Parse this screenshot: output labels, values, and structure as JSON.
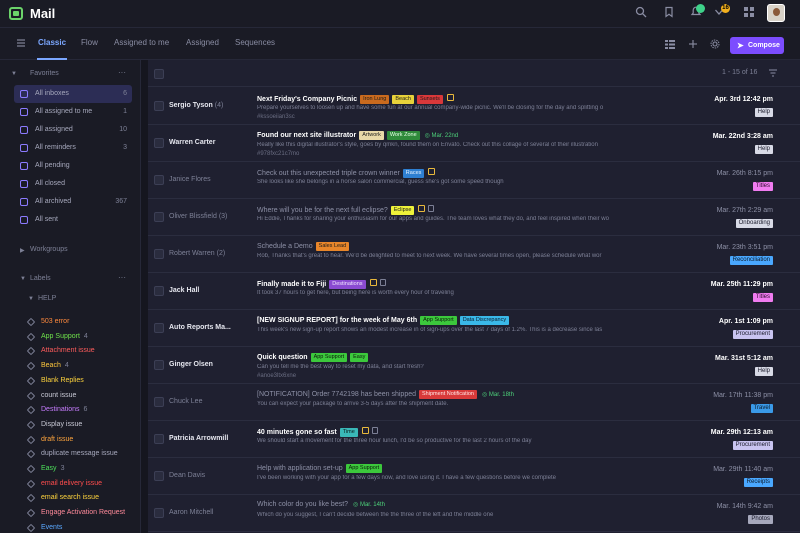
{
  "app": {
    "title": "Mail"
  },
  "topbar": {
    "icons": [
      "search-icon",
      "bookmark-icon",
      "notifications-icon",
      "alerts-icon"
    ],
    "badge_count": "16"
  },
  "tabs": [
    {
      "label": "Classic",
      "active": true
    },
    {
      "label": "Flow"
    },
    {
      "label": "Assigned to me"
    },
    {
      "label": "Assigned"
    },
    {
      "label": "Sequences"
    }
  ],
  "compose_label": "Compose",
  "sidebar": {
    "favorites_label": "Favorites",
    "items": [
      {
        "label": "All inboxes",
        "count": "6",
        "active": true
      },
      {
        "label": "All assigned to me",
        "count": "1"
      },
      {
        "label": "All assigned",
        "count": "10"
      },
      {
        "label": "All reminders",
        "count": "3"
      },
      {
        "label": "All pending",
        "count": ""
      },
      {
        "label": "All closed",
        "count": ""
      },
      {
        "label": "All archived",
        "count": "367"
      },
      {
        "label": "All sent",
        "count": ""
      }
    ],
    "workgroups_label": "Workgroups",
    "labels_label": "Labels",
    "help_label": "HELP",
    "labels": [
      {
        "label": "503 error",
        "count": "",
        "color": "#ff8a3d"
      },
      {
        "label": "App Support",
        "count": "4",
        "color": "#6ee14a"
      },
      {
        "label": "Attachment issue",
        "count": "",
        "color": "#ff5c5c"
      },
      {
        "label": "Beach",
        "count": "4",
        "color": "#ffc83d"
      },
      {
        "label": "Blank Replies",
        "count": "",
        "color": "#ffd43d"
      },
      {
        "label": "count issue",
        "count": "",
        "color": "#c9cad6"
      },
      {
        "label": "Destinations",
        "count": "6",
        "color": "#c77dff"
      },
      {
        "label": "Display issue",
        "count": "",
        "color": "#c9cad6"
      },
      {
        "label": "draft issue",
        "count": "",
        "color": "#ffa53d"
      },
      {
        "label": "duplicate message issue",
        "count": "",
        "color": "#a6a8bc"
      },
      {
        "label": "Easy",
        "count": "3",
        "color": "#4de15a"
      },
      {
        "label": "email delivery issue",
        "count": "",
        "color": "#ff4d4d"
      },
      {
        "label": "email search issue",
        "count": "",
        "color": "#ffd43d"
      },
      {
        "label": "Engage Activation Request",
        "count": "",
        "color": "#ff8a9a"
      },
      {
        "label": "Events",
        "count": "",
        "color": "#5aa8ff"
      }
    ]
  },
  "list": {
    "pagination": "1 - 15 of 16"
  },
  "emails": [
    {
      "sender": "Sergio Tyson",
      "count": "(4)",
      "unread": true,
      "subject": "Next Friday's Company Picnic",
      "chips": [
        {
          "t": "Iron Lung",
          "bg": "#c96a1e",
          "fg": "#1a1a1a"
        },
        {
          "t": "Beach",
          "bg": "#e8d23a",
          "fg": "#1a1a1a"
        },
        {
          "t": "Sunsets",
          "bg": "#d9383a",
          "fg": "#1a1a1a"
        }
      ],
      "icons": [
        "note"
      ],
      "preview": "Prepare yourselves to loosen up and have some fun at our annual company-wide picnic. We'll be closing for the day and splitting o",
      "hash": "#kssoeiian3sc",
      "date": "Apr. 3rd 12:42 pm",
      "tag": "Help",
      "tag_bg": "#d8dae6",
      "tag_fg": "#1a1a2a"
    },
    {
      "sender": "Warren Carter",
      "count": "",
      "unread": true,
      "subject": "Found our next site illustrator",
      "chips": [
        {
          "t": "Artwork",
          "bg": "#e8d9a8",
          "fg": "#1a1a1a"
        },
        {
          "t": "Work Zone",
          "bg": "#2f8a3a",
          "fg": "#e8ffe8"
        }
      ],
      "dchip": "Mar. 22nd",
      "preview": "Really like this digital illustrator's style, goes by qmkn, found them on Envato. Check out this collage of several of their illustration",
      "hash": "#978fxc21c7mo",
      "date": "Mar. 22nd 3:28 am",
      "tag": "Help",
      "tag_bg": "#d8dae6",
      "tag_fg": "#1a1a2a"
    },
    {
      "sender": "Janice Flores",
      "count": "",
      "unread": false,
      "subject": "Check out this unexpected triple crown winner",
      "chips": [
        {
          "t": "Races",
          "bg": "#2e7fd1",
          "fg": "#e6f2ff"
        }
      ],
      "icons": [
        "note"
      ],
      "preview": "She looks like she belongs in a horse salon commercial, guess she's got some speed though",
      "hash": "",
      "date": "Mar. 26th 8:15 pm",
      "tag": "Titles",
      "tag_bg": "#f07cf0",
      "tag_fg": "#2a0a2a"
    },
    {
      "sender": "Oliver Blissfield",
      "count": "(3)",
      "unread": false,
      "subject": "Where will you be for the next full eclipse?",
      "chips": [
        {
          "t": "Eclipse",
          "bg": "#eef23a",
          "fg": "#1a1a1a"
        }
      ],
      "icons": [
        "note",
        "cal"
      ],
      "preview": "Hi Eddie, Thanks for sharing your enthusiasm for our apps and guides. The team loves what they do, and feel inspired when their wo",
      "hash": "",
      "date": "Mar. 27th 2:29 am",
      "tag": "Onboarding",
      "tag_bg": "#d8dae6",
      "tag_fg": "#1a1a2a"
    },
    {
      "sender": "Robert Warren",
      "count": "(2)",
      "unread": false,
      "subject": "Schedule a Demo",
      "chips": [
        {
          "t": "Sales Lead",
          "bg": "#e8862a",
          "fg": "#1a1a1a"
        }
      ],
      "preview": "Rob, Thanks that's great to hear. We'd be delighted to meet to next week. We have several times open, please schedule what wor",
      "hash": "",
      "date": "Mar. 23th 3:51 pm",
      "tag": "Reconciliation",
      "tag_bg": "#4aa8ff",
      "tag_fg": "#0a1a2a"
    },
    {
      "sender": "Jack Hall",
      "count": "",
      "unread": true,
      "subject": "Finally made it to Fiji",
      "chips": [
        {
          "t": "Destinations",
          "bg": "#8a4ad1",
          "fg": "#f2e6ff"
        }
      ],
      "icons": [
        "note",
        "cal"
      ],
      "preview": "It took 37 hours to get here, but being here is worth every hour of traveling",
      "hash": "",
      "date": "Mar. 25th 11:29 pm",
      "tag": "Titles",
      "tag_bg": "#f07cf0",
      "tag_fg": "#2a0a2a"
    },
    {
      "sender": "Auto Reports Ma...",
      "count": "",
      "unread": true,
      "subject": "[NEW SIGNUP REPORT] for the week of May 6th",
      "chips": [
        {
          "t": "App Support",
          "bg": "#3cc83c",
          "fg": "#0a1a0a"
        },
        {
          "t": "Data Discrepancy",
          "bg": "#3ab8e8",
          "fg": "#0a1a2a"
        }
      ],
      "preview": "This week's new sign-up report shows an modest increase in of sign-ups over the last 7 days of 1.2%. This is a decrease since las",
      "hash": "",
      "date": "Apr. 1st 1:09 pm",
      "tag": "Procurement",
      "tag_bg": "#c9c4f0",
      "tag_fg": "#1a1a2a"
    },
    {
      "sender": "Ginger Olsen",
      "count": "",
      "unread": true,
      "subject": "Quick question",
      "chips": [
        {
          "t": "App Support",
          "bg": "#3cc83c",
          "fg": "#0a1a0a"
        },
        {
          "t": "Easy",
          "bg": "#3cc83c",
          "fg": "#0a1a0a"
        }
      ],
      "preview": "Can you tell me the best way to reset my data, and start fresh?",
      "hash": "#anoe3ltx6xne",
      "date": "Mar. 31st 5:12 am",
      "tag": "Help",
      "tag_bg": "#d8dae6",
      "tag_fg": "#1a1a2a"
    },
    {
      "sender": "Chuck Lee",
      "count": "",
      "unread": false,
      "subject": "[NOTIFICATION] Order 7742198 has been shipped",
      "chips": [
        {
          "t": "Shipment Notification",
          "bg": "#d93a3a",
          "fg": "#ffe6e6"
        }
      ],
      "dchip": "Mar. 18th",
      "preview": "You can expect your package to arrive 3-5 days after the shipment date.",
      "hash": "",
      "date": "Mar. 17th 11:38 pm",
      "tag": "Travel",
      "tag_bg": "#3a9ae8",
      "tag_fg": "#0a1a2a"
    },
    {
      "sender": "Patricia Arrowmill",
      "count": "",
      "unread": true,
      "subject": "40 minutes gone so fast",
      "chips": [
        {
          "t": "Time",
          "bg": "#3ab8b8",
          "fg": "#0a1a1a"
        }
      ],
      "icons": [
        "note",
        "cal"
      ],
      "preview": "We should start a movement for the three hour lunch, I'd be so productive for the last 2 hours of the day",
      "hash": "",
      "date": "Mar. 29th 12:13 am",
      "tag": "Procurement",
      "tag_bg": "#c9c4f0",
      "tag_fg": "#1a1a2a"
    },
    {
      "sender": "Dean Davis",
      "count": "",
      "unread": false,
      "subject": "Help with application set-up",
      "chips": [
        {
          "t": "App Support",
          "bg": "#3cc83c",
          "fg": "#0a1a0a"
        }
      ],
      "preview": "I've been working with your app for a few days now, and love using it. I have a few questions before we complete",
      "hash": "",
      "date": "Mar. 29th 11:40 am",
      "tag": "Receipts",
      "tag_bg": "#4aa8ff",
      "tag_fg": "#0a1a2a"
    },
    {
      "sender": "Aaron Mitchell",
      "count": "",
      "unread": false,
      "subject": "Which color do you like best?",
      "chips": [],
      "dchip": "Mar. 14th",
      "preview": "Which do you suggest, I can't decide between the the three of the left and the middle one",
      "hash": "",
      "date": "Mar. 14th 9:42 am",
      "tag": "Photos",
      "tag_bg": "#a6a8bc",
      "tag_fg": "#1a1a2a"
    }
  ]
}
